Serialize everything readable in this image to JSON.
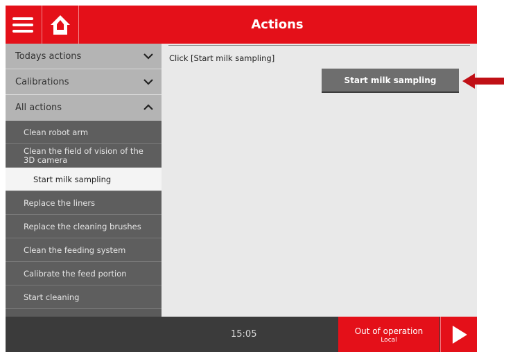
{
  "header": {
    "title": "Actions"
  },
  "sidebar": {
    "sections": [
      {
        "label": "Todays actions",
        "expanded": false
      },
      {
        "label": "Calibrations",
        "expanded": false
      },
      {
        "label": "All actions",
        "expanded": true
      }
    ],
    "items": [
      {
        "label": "Clean robot arm"
      },
      {
        "label": "Clean the field of vision of the 3D camera"
      },
      {
        "label": "Start milk sampling",
        "selected": true
      },
      {
        "label": "Replace the liners"
      },
      {
        "label": "Replace the cleaning brushes"
      },
      {
        "label": "Clean the feeding system"
      },
      {
        "label": "Calibrate the feed portion"
      },
      {
        "label": "Start cleaning"
      }
    ]
  },
  "main": {
    "instruction": "Click [Start  milk sampling]",
    "start_button_label": "Start milk sampling"
  },
  "footer": {
    "time": "15:05",
    "status_main": "Out of operation",
    "status_sub": "Local"
  },
  "colors": {
    "brand_red": "#e41019",
    "pointer_arrow": "#c01016",
    "button_gray": "#6e6e6e"
  },
  "icons": [
    "menu-icon",
    "home-icon",
    "chevron-down-icon",
    "chevron-up-icon",
    "play-icon",
    "arrow-left-icon"
  ]
}
